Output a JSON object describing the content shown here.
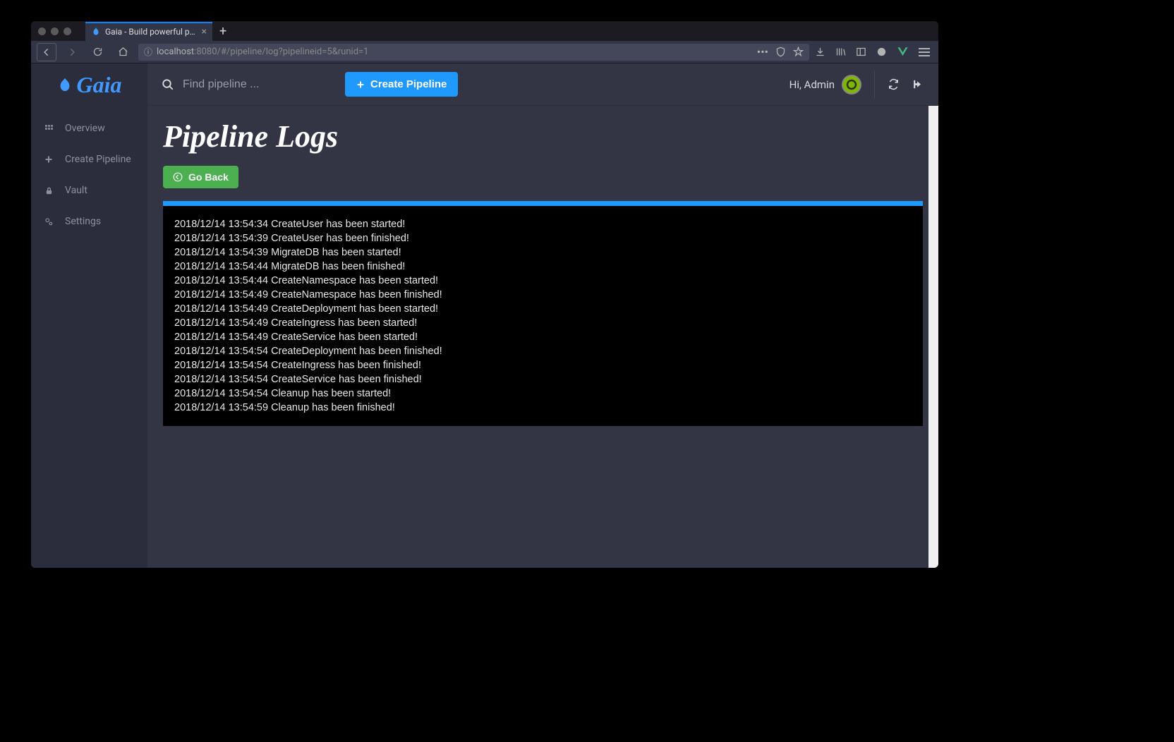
{
  "browser": {
    "tab_title": "Gaia - Build powerful pipelines",
    "url_host": "localhost",
    "url_port": ":8080",
    "url_path": "/#/pipeline/log?pipelineid=5&runid=1"
  },
  "app": {
    "logo_text": "Gaia",
    "nav": [
      {
        "icon": "grid",
        "label": "Overview"
      },
      {
        "icon": "plus",
        "label": "Create Pipeline"
      },
      {
        "icon": "lock",
        "label": "Vault"
      },
      {
        "icon": "cogs",
        "label": "Settings"
      }
    ],
    "search_placeholder": "Find pipeline ...",
    "create_label": "Create Pipeline",
    "greeting_prefix": "Hi, ",
    "greeting_name": "Admin"
  },
  "page": {
    "title": "Pipeline Logs",
    "back_label": "Go Back",
    "logs": [
      "2018/12/14 13:54:34 CreateUser has been started!",
      "2018/12/14 13:54:39 CreateUser has been finished!",
      "2018/12/14 13:54:39 MigrateDB has been started!",
      "2018/12/14 13:54:44 MigrateDB has been finished!",
      "2018/12/14 13:54:44 CreateNamespace has been started!",
      "2018/12/14 13:54:49 CreateNamespace has been finished!",
      "2018/12/14 13:54:49 CreateDeployment has been started!",
      "2018/12/14 13:54:49 CreateIngress has been started!",
      "2018/12/14 13:54:49 CreateService has been started!",
      "2018/12/14 13:54:54 CreateDeployment has been finished!",
      "2018/12/14 13:54:54 CreateIngress has been finished!",
      "2018/12/14 13:54:54 CreateService has been finished!",
      "2018/12/14 13:54:54 Cleanup has been started!",
      "2018/12/14 13:54:59 Cleanup has been finished!"
    ]
  }
}
